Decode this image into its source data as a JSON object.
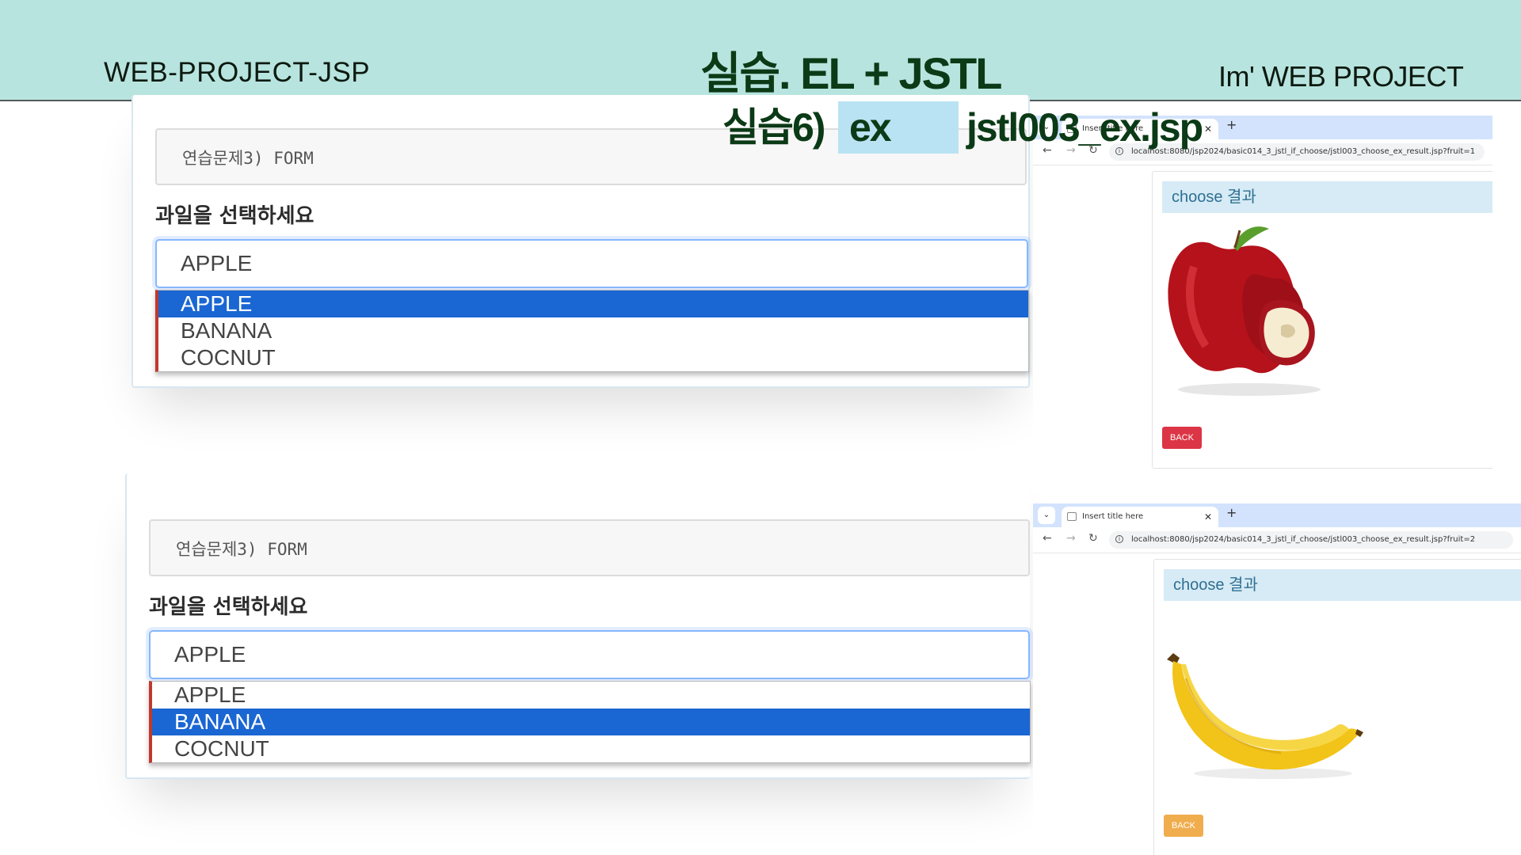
{
  "slide": {
    "brand_left": "WEB-PROJECT-JSP",
    "title": "실습. EL + JSTL",
    "brand_right": "Im'  WEB PROJECT",
    "subtitle_prefix": "실습6)",
    "subtitle_chip": "ex",
    "subtitle_file": "jstl003_ex.jsp"
  },
  "forms": [
    {
      "header": "연습문제3) FORM",
      "label": "과일을 선택하세요",
      "select_value": "APPLE",
      "options": [
        "APPLE",
        "BANANA",
        "COCNUT"
      ],
      "highlighted_index": 0
    },
    {
      "header": "연습문제3) FORM",
      "label": "과일을 선택하세요",
      "select_value": "APPLE",
      "options": [
        "APPLE",
        "BANANA",
        "COCNUT"
      ],
      "highlighted_index": 1
    }
  ],
  "browsers": [
    {
      "tab_title": "Insert title here",
      "url": "localhost:8080/jsp2024/basic014_3_jstl_if_choose/jstl003_choose_ex_result.jsp?fruit=1",
      "card_title": "choose 결과",
      "image": "apple-image",
      "back_label": "BACK",
      "back_color": "#dc3545"
    },
    {
      "tab_title": "Insert title here",
      "url": "localhost:8080/jsp2024/basic014_3_jstl_if_choose/jstl003_choose_ex_result.jsp?fruit=2",
      "card_title": "choose 결과",
      "image": "banana-image",
      "back_label": "BACK",
      "back_color": "#f0ad4e"
    }
  ],
  "icons": {
    "back": "arrow-left-icon",
    "forward": "arrow-right-icon",
    "reload": "reload-icon",
    "info": "site-info-icon",
    "new_tab": "plus-icon",
    "close": "close-icon"
  },
  "colors": {
    "header_band": "#b8e4df",
    "title_green": "#0b3a16",
    "select_highlight": "#1a66d3"
  }
}
